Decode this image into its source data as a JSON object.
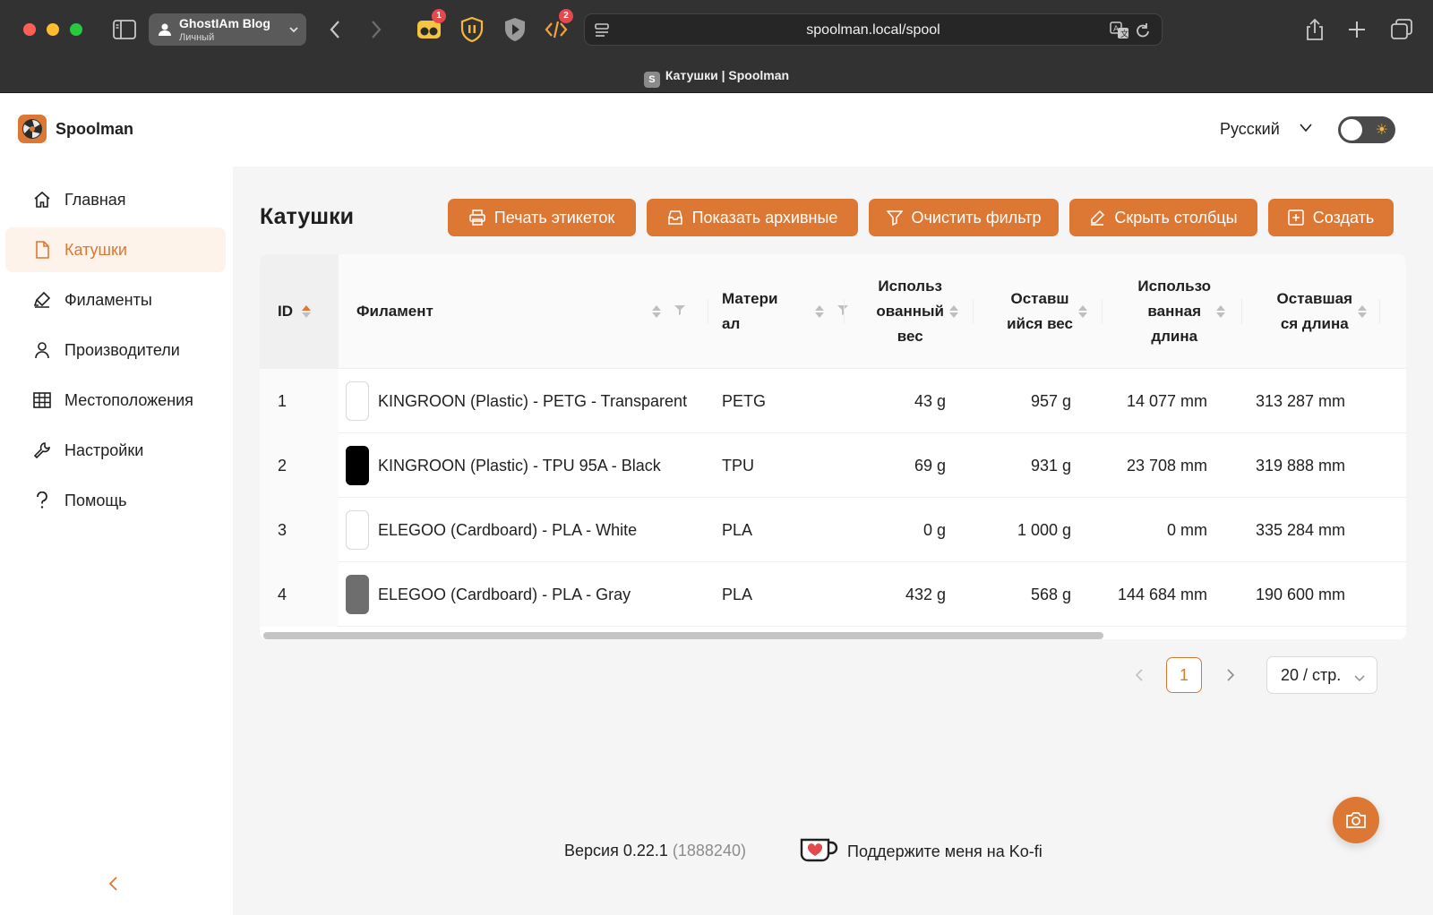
{
  "browser": {
    "profile_name": "GhostIAm Blog",
    "profile_sub": "Личный",
    "url": "spoolman.local/spool",
    "tab_favicon": "S",
    "tab_title": "Катушки | Spoolman",
    "extensions": [
      {
        "name": "tampermonkey-icon",
        "badge": "1"
      },
      {
        "name": "ublock-icon",
        "badge": ""
      },
      {
        "name": "shield-icon",
        "badge": ""
      },
      {
        "name": "code-icon",
        "badge": "2"
      }
    ]
  },
  "header": {
    "brand": "Spoolman",
    "language": "Русский"
  },
  "sidebar": {
    "items": [
      {
        "label": "Главная",
        "icon": "home-icon"
      },
      {
        "label": "Катушки",
        "icon": "file-icon",
        "active": true
      },
      {
        "label": "Филаменты",
        "icon": "highlighter-icon"
      },
      {
        "label": "Производители",
        "icon": "user-icon"
      },
      {
        "label": "Местоположения",
        "icon": "table-icon"
      },
      {
        "label": "Настройки",
        "icon": "wrench-icon"
      },
      {
        "label": "Помощь",
        "icon": "question-icon"
      }
    ]
  },
  "page": {
    "title": "Катушки",
    "buttons": {
      "print": "Печать этикеток",
      "archived": "Показать архивные",
      "clear_filter": "Очистить фильтр",
      "hide_columns": "Скрыть столбцы",
      "create": "Создать"
    }
  },
  "table": {
    "headers": {
      "id": "ID",
      "filament": "Филамент",
      "material_1": "Матери",
      "material_2": "ал",
      "used_weight_1": "Использ",
      "used_weight_2": "ованный",
      "used_weight_3": "вес",
      "remaining_weight_1": "Оставш",
      "remaining_weight_2": "ийся вес",
      "used_length_1": "Использо",
      "used_length_2": "ванная",
      "used_length_3": "длина",
      "remaining_length_1": "Оставшая",
      "remaining_length_2": "ся длина"
    },
    "rows": [
      {
        "id": "1",
        "filament": "KINGROON (Plastic) - PETG - Transparent",
        "color": "#ffffff",
        "material": "PETG",
        "used_weight": "43 g",
        "remaining_weight": "957 g",
        "used_length": "14 077 mm",
        "remaining_length": "313 287 mm"
      },
      {
        "id": "2",
        "filament": "KINGROON (Plastic) - TPU 95A - Black",
        "color": "#000000",
        "material": "TPU",
        "used_weight": "69 g",
        "remaining_weight": "931 g",
        "used_length": "23 708 mm",
        "remaining_length": "319 888 mm"
      },
      {
        "id": "3",
        "filament": "ELEGOO (Cardboard) - PLA - White",
        "color": "#ffffff",
        "material": "PLA",
        "used_weight": "0 g",
        "remaining_weight": "1 000 g",
        "used_length": "0 mm",
        "remaining_length": "335 284 mm"
      },
      {
        "id": "4",
        "filament": "ELEGOO (Cardboard) - PLA - Gray",
        "color": "#6e6e6e",
        "material": "PLA",
        "used_weight": "432 g",
        "remaining_weight": "568 g",
        "used_length": "144 684 mm",
        "remaining_length": "190 600 mm"
      }
    ]
  },
  "pagination": {
    "current_page": "1",
    "page_size": "20 / стр."
  },
  "footer": {
    "version": "Версия 0.22.1",
    "commit": "(1888240)",
    "kofi": "Поддержите меня на Ko-fi"
  },
  "colors": {
    "accent": "#dc7734",
    "chrome": "#323232",
    "main_bg": "#f5f5f5"
  }
}
